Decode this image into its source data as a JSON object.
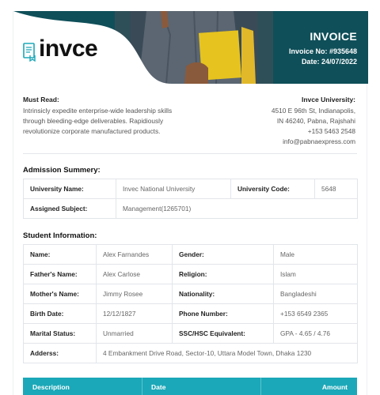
{
  "header": {
    "logo_text": "invce",
    "title": "INVOICE",
    "invoice_no": "Invoice No: #935648",
    "date": "Date: 24/07/2022"
  },
  "must_read": {
    "heading": "Must Read:",
    "lines": [
      "Intrinsicly expedite enterprise-wide leadership skills",
      "through bleeding-edge deliverables. Rapidiously",
      "revolutionize corporate manufactured products."
    ]
  },
  "university": {
    "heading": "Invce University:",
    "lines": [
      "4510 E 96th St, Indianapolis,",
      "IN 46240, Pabna, Rajshahi",
      "+153 5463 2548",
      "info@pabnaexpress.com"
    ]
  },
  "admission": {
    "title": "Admission Summery:",
    "university_name_label": "University Name:",
    "university_name": "Invec National University",
    "university_code_label": "University Code:",
    "university_code": "5648",
    "assigned_subject_label": "Assigned Subject:",
    "assigned_subject": "Management(1265701)"
  },
  "student": {
    "title": "Student Information:",
    "rows": [
      {
        "l1": "Name:",
        "v1": "Alex Farnandes",
        "l2": "Gender:",
        "v2": "Male"
      },
      {
        "l1": "Father's Name:",
        "v1": "Alex Carlose",
        "l2": "Religion:",
        "v2": "Islam"
      },
      {
        "l1": "Mother's Name:",
        "v1": "Jimmy Rosee",
        "l2": "Nationality:",
        "v2": "Bangladeshi"
      },
      {
        "l1": "Birth Date:",
        "v1": "12/12/1827",
        "l2": "Phone Number:",
        "v2": "+153 6549 2365"
      },
      {
        "l1": "Marital Status:",
        "v1": "Unmarried",
        "l2": "SSC/HSC Equivalent:",
        "v2": "GPA - 4.65 / 4.76"
      }
    ],
    "address_label": "Adderss:",
    "address": "4 Embankment Drive Road, Sector-10, Uttara Model Town, Dhaka 1230"
  },
  "items_table": {
    "description": "Description",
    "date": "Date",
    "amount": "Amount"
  },
  "colors": {
    "teal_dark": "#0f4f59",
    "teal_accent": "#1ba8b8"
  }
}
